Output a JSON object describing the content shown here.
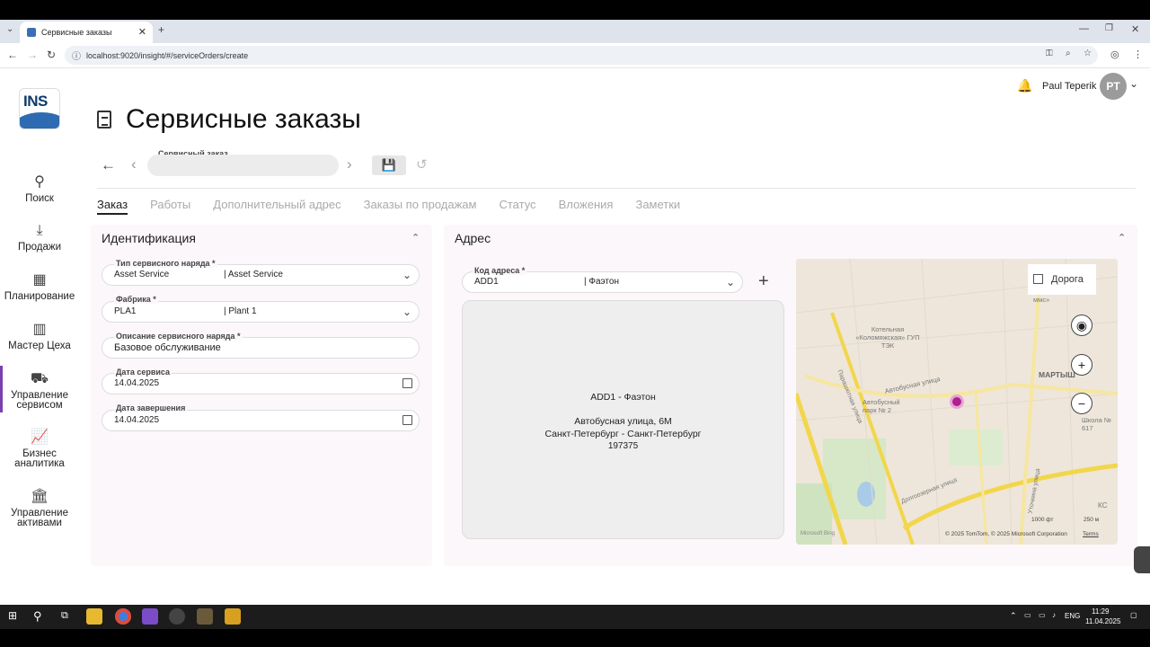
{
  "browser": {
    "tab_title": "Сервисные заказы",
    "new_tab": "+",
    "url": "localhost:9020/insight/#/serviceOrders/create"
  },
  "app": {
    "logo_text": "INS",
    "page_title": "Сервисные заказы",
    "user_name": "Paul Teperik",
    "user_initials": "PT",
    "sidebar": [
      {
        "label": "Поиск",
        "icon": "search-icon"
      },
      {
        "label": "Продажи",
        "icon": "download-icon"
      },
      {
        "label": "Планирование",
        "icon": "calendar-icon"
      },
      {
        "label": "Мастер Цеха",
        "icon": "barcode-icon"
      },
      {
        "label": "Управление сервисом",
        "icon": "truck-icon",
        "active": true
      },
      {
        "label": "Бизнес аналитика",
        "icon": "chart-icon"
      },
      {
        "label": "Управление активами",
        "icon": "bank-icon"
      }
    ],
    "toolbar": {
      "order_label": "Сервисный заказ",
      "order_value": ""
    },
    "tabs": [
      "Заказ",
      "Работы",
      "Дополнительный адрес",
      "Заказы по продажам",
      "Статус",
      "Вложения",
      "Заметки"
    ],
    "active_tab": "Заказ",
    "identification": {
      "title": "Идентификация",
      "fields": [
        {
          "label": "Тип сервисного наряда *",
          "value": "Asset Service",
          "sub": "| Asset Service",
          "kind": "select"
        },
        {
          "label": "Фабрика *",
          "value": "PLA1",
          "sub": "| Plant 1",
          "kind": "select"
        },
        {
          "label": "Описание сервисного наряда *",
          "value": "Базовое обслуживание",
          "sub": "",
          "kind": "text"
        },
        {
          "label": "Дата сервиса",
          "value": "14.04.2025",
          "sub": "",
          "kind": "date"
        },
        {
          "label": "Дата завершения",
          "value": "14.04.2025",
          "sub": "",
          "kind": "date"
        }
      ]
    },
    "address": {
      "title": "Адрес",
      "code_label": "Код адреса *",
      "code_value": "ADD1",
      "code_sub": "| Фаэтон",
      "card_title": "ADD1 - Фаэтон",
      "card_line1": "Автобусная улица, 6М",
      "card_line2": "Санкт-Петербург - Санкт-Петербург",
      "card_line3": "197375"
    },
    "map": {
      "layer_button": "Дорога",
      "label_boiler": "Котельная «Коломяжская» ГУП ТЭК",
      "label_street1": "Автобусная улица",
      "label_park": "Автобусный парк № 2",
      "label_martyn": "МАРТЫШ",
      "label_school": "Школа № 617",
      "label_street2": "Парашютная улица",
      "label_street3": "Долгоозерная улица",
      "label_street4": "Уточкина улица",
      "label_mms": "ммс»",
      "scale_ft": "1000 фт",
      "scale_m": "250 м",
      "copyright": "© 2025 TomTom, © 2025 Microsoft Corporation",
      "terms": "Terms",
      "brand": "Microsoft Bing",
      "kc": "КС"
    }
  },
  "taskbar": {
    "lang": "ENG",
    "time": "11:29",
    "date": "11.04.2025"
  }
}
